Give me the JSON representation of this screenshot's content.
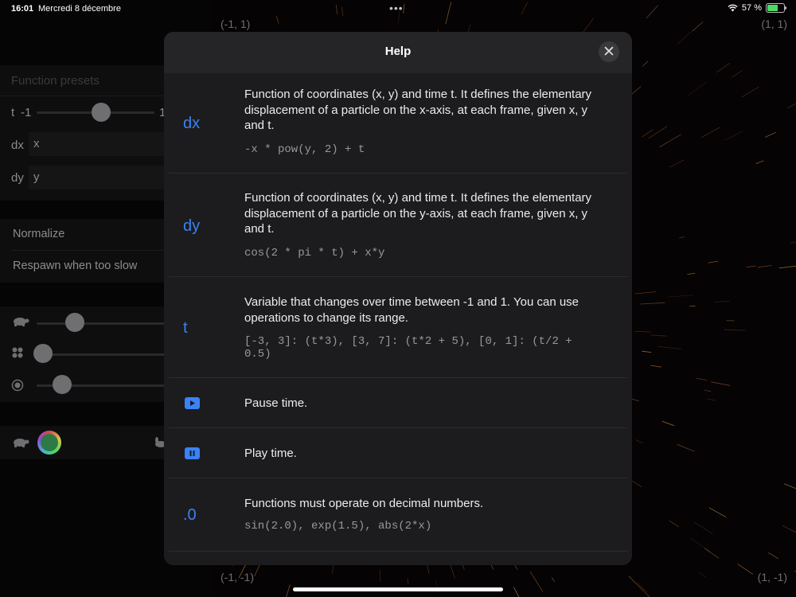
{
  "status": {
    "time": "16:01",
    "date": "Mercredi 8 décembre",
    "battery": "57 %"
  },
  "corners": {
    "top_left": "(-1, 1)",
    "top_right": "(1, 1)",
    "bottom_left": "(-1, -1)",
    "bottom_right": "(1, -1)"
  },
  "panel": {
    "presets_label": "Function presets",
    "t_label": "t",
    "t_min": "-1",
    "t_max": "1",
    "dx_label": "dx",
    "dx_value": "x",
    "dy_label": "dy",
    "dy_value": "y",
    "normalize_label": "Normalize",
    "respawn_label": "Respawn when too slow",
    "t_slider_value": 0.55,
    "speed_slider_value": 0.3,
    "count_slider_value": 0.05,
    "size_slider_value": 0.2
  },
  "help": {
    "title": "Help",
    "items": [
      {
        "symbol": "dx",
        "description": "Function of coordinates (x, y) and time t. It defines the elementary displacement of a particle on the x-axis, at each frame, given x, y and t.",
        "example": "-x * pow(y, 2) + t"
      },
      {
        "symbol": "dy",
        "description": "Function of coordinates (x, y) and time t. It defines the elementary displacement of a particle on the y-axis, at each frame, given x, y and t.",
        "example": "cos(2 * pi * t) + x*y"
      },
      {
        "symbol": "t",
        "description": "Variable that changes over time between -1 and 1. You can use operations to change its range.",
        "example": "[-3, 3]: (t*3), [3, 7]: (t*2 + 5), [0, 1]: (t/2 + 0.5)"
      },
      {
        "symbol": "play-icon",
        "description": "Pause time."
      },
      {
        "symbol": "pause-icon",
        "description": "Play time."
      },
      {
        "symbol": ".0",
        "description": "Functions must operate on decimal numbers.",
        "example": "sin(2.0), exp(1.5), abs(2*x)"
      }
    ]
  },
  "colors": {
    "accent": "#3a82f7",
    "modal_bg": "#1c1c1e",
    "header_bg": "#252527"
  }
}
